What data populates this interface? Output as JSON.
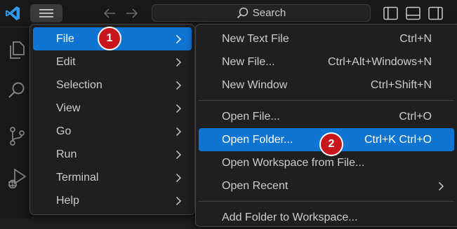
{
  "titlebar": {
    "search_label": "Search"
  },
  "menu": {
    "items": [
      {
        "label": "File"
      },
      {
        "label": "Edit"
      },
      {
        "label": "Selection"
      },
      {
        "label": "View"
      },
      {
        "label": "Go"
      },
      {
        "label": "Run"
      },
      {
        "label": "Terminal"
      },
      {
        "label": "Help"
      }
    ],
    "selected": "File"
  },
  "file_menu": {
    "items": [
      {
        "label": "New Text File",
        "shortcut": "Ctrl+N"
      },
      {
        "label": "New File...",
        "shortcut": "Ctrl+Alt+Windows+N"
      },
      {
        "label": "New Window",
        "shortcut": "Ctrl+Shift+N"
      },
      {
        "label": "Open File...",
        "shortcut": "Ctrl+O"
      },
      {
        "label": "Open Folder...",
        "shortcut": "Ctrl+K Ctrl+O"
      },
      {
        "label": "Open Workspace from File..."
      },
      {
        "label": "Open Recent"
      },
      {
        "label": "Add Folder to Workspace..."
      }
    ],
    "highlighted": "Open Folder..."
  },
  "annotations": {
    "step1": "1",
    "step2": "2"
  },
  "colors": {
    "accent": "#0f74d2",
    "badge": "#c8171c",
    "background": "#1f1f1f",
    "vscode_blue": "#2d9bf0"
  }
}
